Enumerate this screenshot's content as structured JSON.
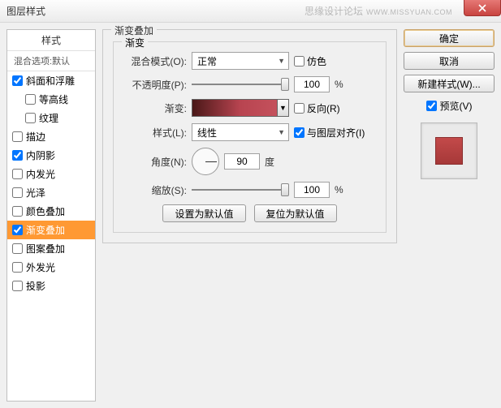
{
  "window": {
    "title": "图层样式",
    "watermark": "思缘设计论坛",
    "watermark_url": "WWW.MISSYUAN.COM"
  },
  "sidebar": {
    "header": "样式",
    "sub": "混合选项:默认",
    "items": [
      {
        "label": "斜面和浮雕",
        "checked": true
      },
      {
        "label": "等高线",
        "checked": false,
        "indent": true
      },
      {
        "label": "纹理",
        "checked": false,
        "indent": true
      },
      {
        "label": "描边",
        "checked": false
      },
      {
        "label": "内阴影",
        "checked": true
      },
      {
        "label": "内发光",
        "checked": false
      },
      {
        "label": "光泽",
        "checked": false
      },
      {
        "label": "颜色叠加",
        "checked": false
      },
      {
        "label": "渐变叠加",
        "checked": true,
        "selected": true
      },
      {
        "label": "图案叠加",
        "checked": false
      },
      {
        "label": "外发光",
        "checked": false
      },
      {
        "label": "投影",
        "checked": false
      }
    ]
  },
  "panel": {
    "group_title": "渐变叠加",
    "subgroup_title": "渐变",
    "blend_label": "混合模式(O):",
    "blend_value": "正常",
    "dither_label": "仿色",
    "opacity_label": "不透明度(P):",
    "opacity_value": "100",
    "percent": "%",
    "gradient_label": "渐变:",
    "reverse_label": "反向(R)",
    "style_label": "样式(L):",
    "style_value": "线性",
    "align_label": "与图层对齐(I)",
    "angle_label": "角度(N):",
    "angle_value": "90",
    "degree": "度",
    "scale_label": "缩放(S):",
    "scale_value": "100",
    "reset_default": "设置为默认值",
    "restore_default": "复位为默认值"
  },
  "actions": {
    "ok": "确定",
    "cancel": "取消",
    "new_style": "新建样式(W)...",
    "preview": "预览(V)"
  }
}
